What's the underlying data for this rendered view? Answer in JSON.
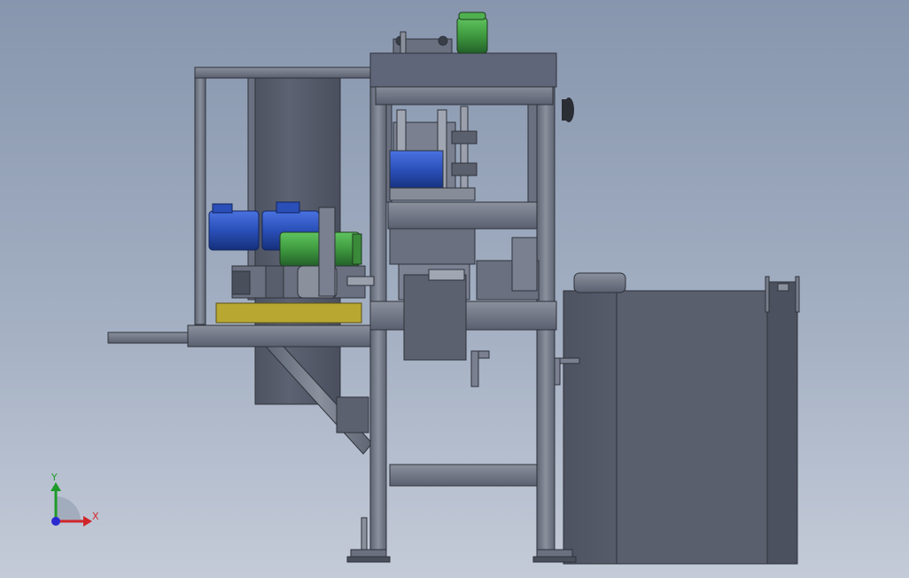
{
  "triad": {
    "y_label": "Y",
    "x_label": "X",
    "y_color": "#1f9a2a",
    "x_color": "#d0262a",
    "z_color": "#2a2ad0"
  },
  "colors": {
    "frame": "#6f7785",
    "frame_dark": "#4a505c",
    "panel": "#5b6070",
    "motor_blue": "#2a4fb8",
    "motor_green": "#3f9a3f",
    "base_yellow": "#b8a832",
    "outline": "#2e323a"
  }
}
